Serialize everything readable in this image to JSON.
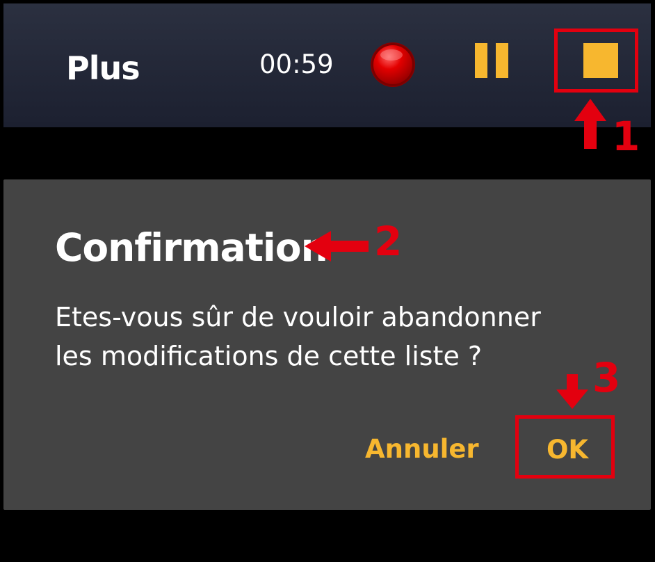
{
  "toolbar": {
    "more_label": "Plus",
    "timer": "00:59",
    "record_icon": "record-icon",
    "pause_icon": "pause-icon",
    "stop_icon": "stop-icon"
  },
  "dialog": {
    "title": "Confirmation",
    "message_line1": "Etes-vous sûr de vouloir abandonner",
    "message_line2": "les modifications de cette liste ?",
    "cancel_label": "Annuler",
    "ok_label": "OK"
  },
  "annotations": {
    "step1": "1",
    "step2": "2",
    "step3": "3"
  },
  "colors": {
    "accent": "#f7b72f",
    "annotation": "#e3000f",
    "record": "#e30000",
    "dialog_bg": "#444444",
    "toolbar_bg": "#232838"
  }
}
